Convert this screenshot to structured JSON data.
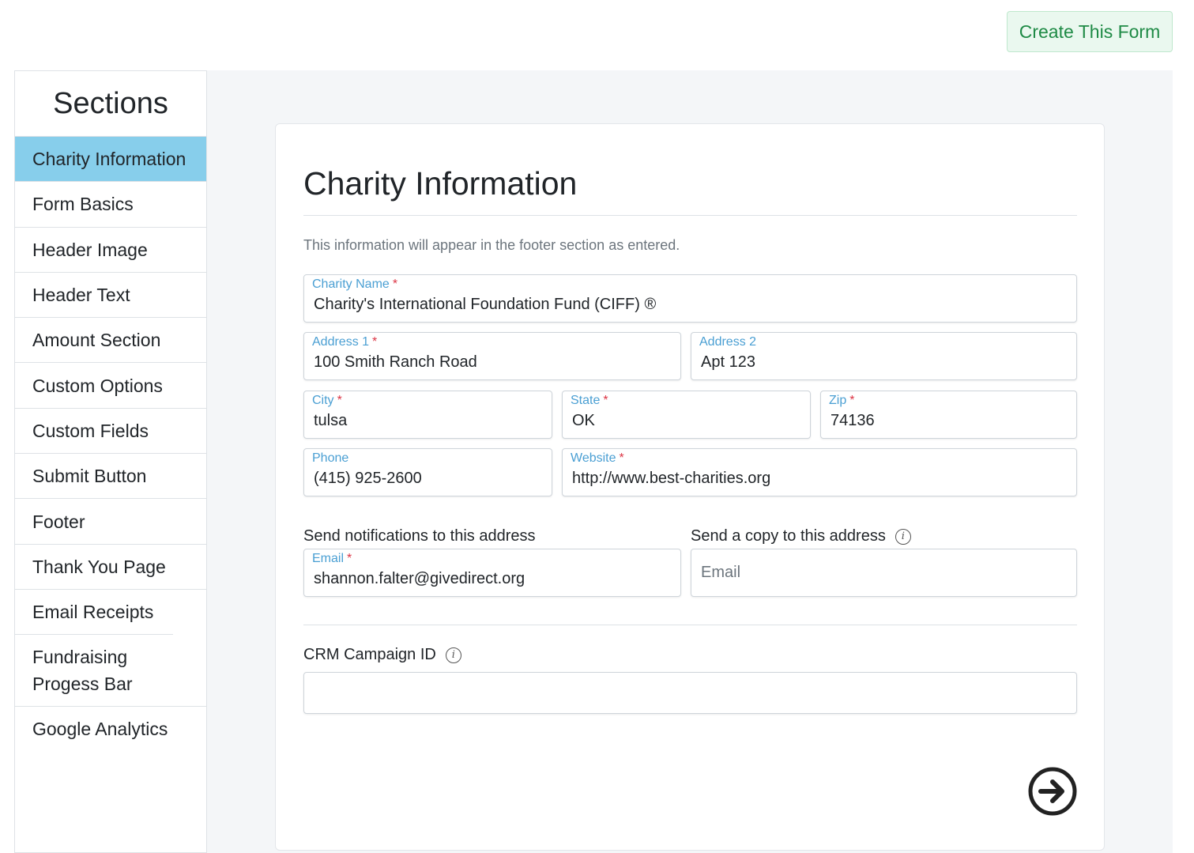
{
  "header": {
    "create_button": "Create This Form"
  },
  "sidebar": {
    "title": "Sections",
    "items": [
      {
        "label": "Charity Information",
        "active": true
      },
      {
        "label": "Form Basics"
      },
      {
        "label": "Header Image"
      },
      {
        "label": "Header Text"
      },
      {
        "label": "Amount Section"
      },
      {
        "label": "Custom Options"
      },
      {
        "label": "Custom Fields"
      },
      {
        "label": "Submit Button"
      },
      {
        "label": "Footer"
      },
      {
        "label": "Thank You Page"
      },
      {
        "label": "Email Receipts"
      },
      {
        "label": "Fundraising Progess Bar"
      },
      {
        "label": "Google Analytics"
      }
    ]
  },
  "main": {
    "title": "Charity Information",
    "info": "This information will appear in the footer section as entered.",
    "fields": {
      "charity_name": {
        "label": "Charity Name",
        "value": "Charity's International Foundation Fund (CIFF) ®",
        "required": "*"
      },
      "address1": {
        "label": "Address 1",
        "value": "100 Smith Ranch Road",
        "required": "*"
      },
      "address2": {
        "label": "Address 2",
        "value": "Apt 123"
      },
      "city": {
        "label": "City",
        "value": "tulsa",
        "required": "*"
      },
      "state": {
        "label": "State",
        "value": "OK",
        "required": "*"
      },
      "zip": {
        "label": "Zip",
        "value": "74136",
        "required": "*"
      },
      "phone": {
        "label": "Phone",
        "value": "(415) 925-2600"
      },
      "website": {
        "label": "Website",
        "value": "http://www.best-charities.org",
        "required": "*"
      },
      "notify_email": {
        "label": "Email",
        "value": "shannon.falter@givedirect.org",
        "required": "*"
      },
      "copy_email": {
        "placeholder": "Email"
      },
      "crm_campaign_id": {
        "value": ""
      }
    },
    "notify_label": "Send notifications to this address",
    "copy_label": "Send a copy to this address",
    "crm_label": "CRM Campaign ID",
    "info_icon": "i",
    "next_icon": "arrow-right-circle-icon"
  }
}
